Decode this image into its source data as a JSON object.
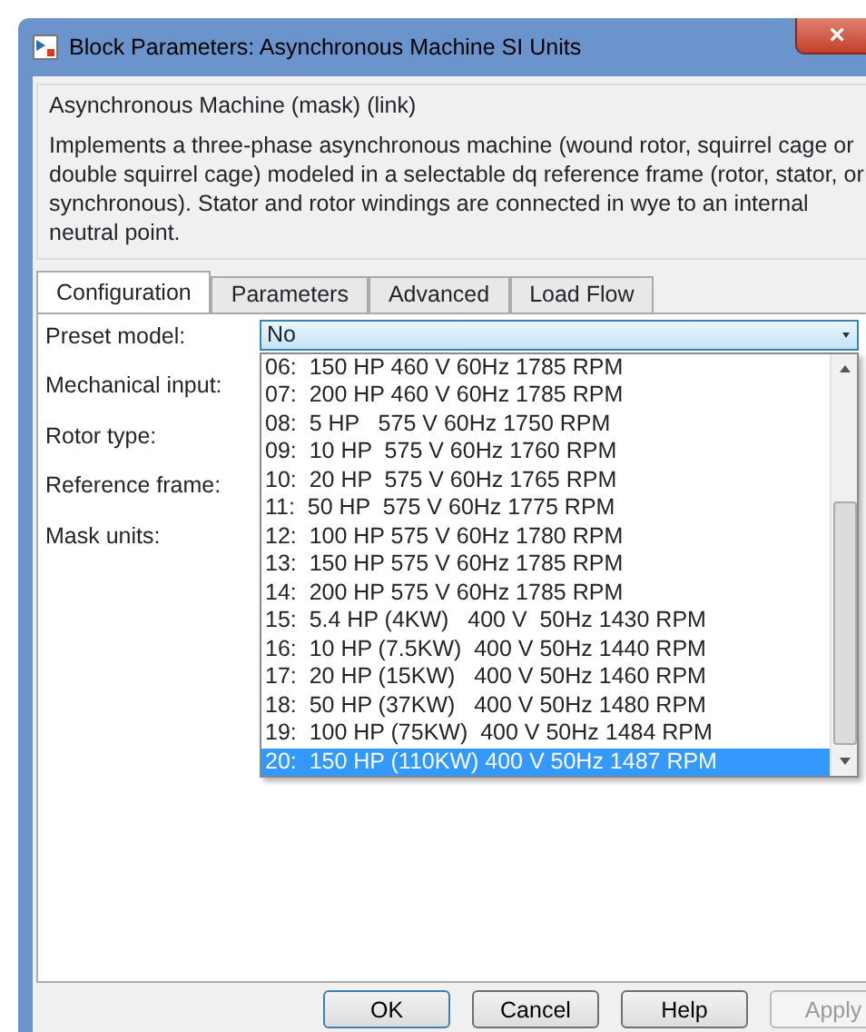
{
  "window": {
    "title": "Block Parameters: Asynchronous Machine SI Units",
    "close": "×"
  },
  "group": {
    "title": "Asynchronous Machine (mask) (link)",
    "description": "Implements a three-phase asynchronous machine (wound rotor, squirrel cage or double squirrel cage) modeled in a selectable dq reference frame (rotor, stator, or synchronous). Stator and rotor windings are connected in wye to an internal neutral point."
  },
  "tabs": [
    {
      "label": "Configuration",
      "selected": true
    },
    {
      "label": "Parameters",
      "selected": false
    },
    {
      "label": "Advanced",
      "selected": false
    },
    {
      "label": "Load Flow",
      "selected": false
    }
  ],
  "fields": [
    {
      "label": "Preset model:"
    },
    {
      "label": "Mechanical input:"
    },
    {
      "label": "Rotor type:"
    },
    {
      "label": "Reference frame:"
    },
    {
      "label": "Mask units:"
    }
  ],
  "preset_dropdown": {
    "value": "No",
    "options": [
      {
        "label": "06:  150 HP 460 V 60Hz 1785 RPM",
        "selected": false
      },
      {
        "label": "07:  200 HP 460 V 60Hz 1785 RPM",
        "selected": false
      },
      {
        "label": "08:  5 HP   575 V 60Hz 1750 RPM",
        "selected": false
      },
      {
        "label": "09:  10 HP  575 V 60Hz 1760 RPM",
        "selected": false
      },
      {
        "label": "10:  20 HP  575 V 60Hz 1765 RPM",
        "selected": false
      },
      {
        "label": "11:  50 HP  575 V 60Hz 1775 RPM",
        "selected": false
      },
      {
        "label": "12:  100 HP 575 V 60Hz 1780 RPM",
        "selected": false
      },
      {
        "label": "13:  150 HP 575 V 60Hz 1785 RPM",
        "selected": false
      },
      {
        "label": "14:  200 HP 575 V 60Hz 1785 RPM",
        "selected": false
      },
      {
        "label": "15:  5.4 HP (4KW)   400 V  50Hz 1430 RPM",
        "selected": false
      },
      {
        "label": "16:  10 HP (7.5KW)  400 V 50Hz 1440 RPM",
        "selected": false
      },
      {
        "label": "17:  20 HP (15KW)   400 V 50Hz 1460 RPM",
        "selected": false
      },
      {
        "label": "18:  50 HP (37KW)   400 V 50Hz 1480 RPM",
        "selected": false
      },
      {
        "label": "19:  100 HP (75KW)  400 V 50Hz 1484 RPM",
        "selected": false
      },
      {
        "label": "20:  150 HP (110KW) 400 V 50Hz 1487 RPM",
        "selected": true
      }
    ]
  },
  "buttons": [
    {
      "label": "OK",
      "disabled": false
    },
    {
      "label": "Cancel",
      "disabled": false
    },
    {
      "label": "Help",
      "disabled": false
    },
    {
      "label": "Apply",
      "disabled": true
    }
  ]
}
